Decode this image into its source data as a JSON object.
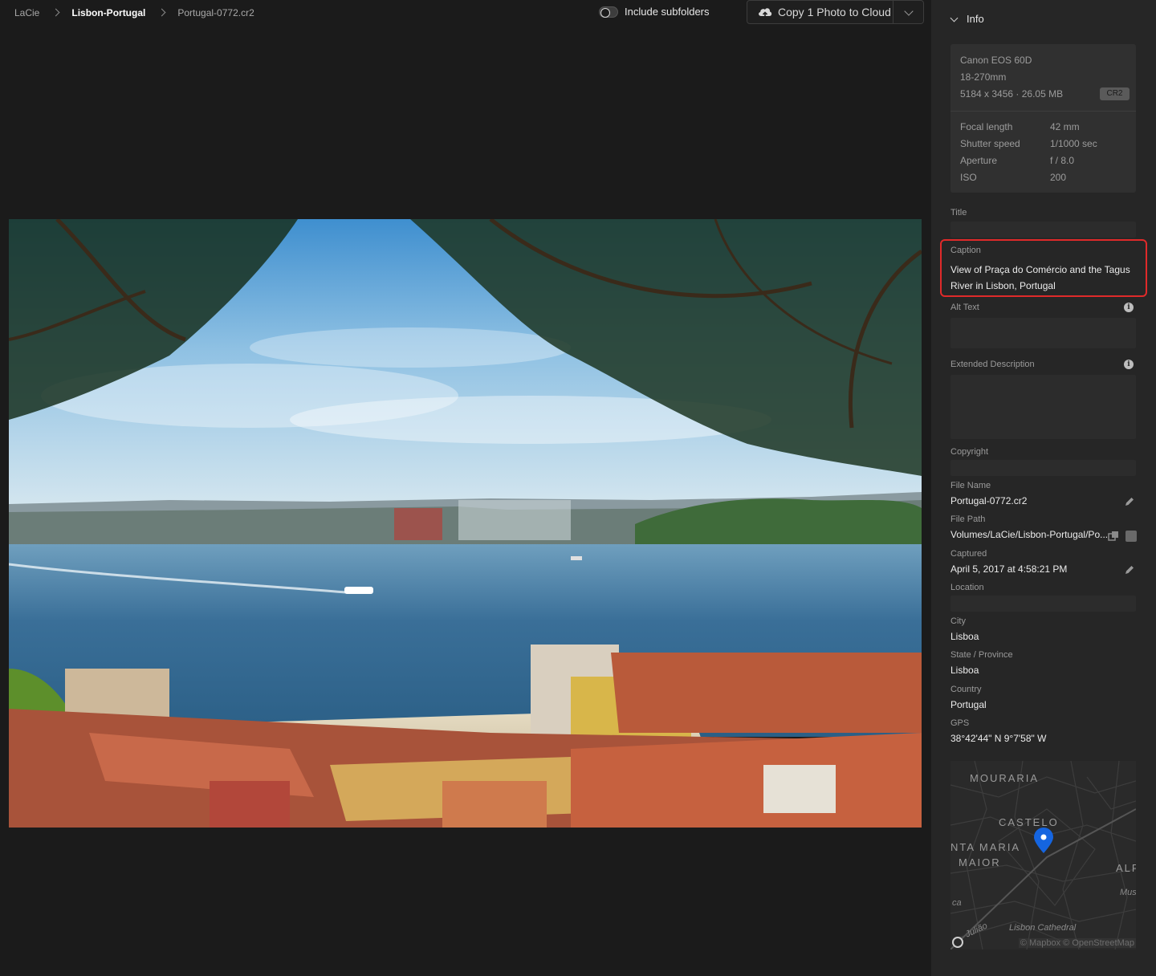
{
  "breadcrumb": {
    "root": "LaCie",
    "folder": "Lisbon-Portugal",
    "file": "Portugal-0772.cr2"
  },
  "toolbar": {
    "include_subfolders": "Include subfolders",
    "copy_button": "Copy 1 Photo to Cloud"
  },
  "panel": {
    "header": "Info",
    "camera": "Canon EOS 60D",
    "lens": "18-270mm",
    "dimensions": "5184 x 3456  ·  26.05 MB",
    "format_badge": "CR2",
    "exif": [
      {
        "label": "Focal length",
        "value": "42 mm"
      },
      {
        "label": "Shutter speed",
        "value": "1/1000 sec"
      },
      {
        "label": "Aperture",
        "value": "f / 8.0"
      },
      {
        "label": "ISO",
        "value": "200"
      }
    ],
    "title_label": "Title",
    "caption_label": "Caption",
    "caption_value": "View of Praça do Comércio and the Tagus River in Lisbon, Portugal",
    "alt_text_label": "Alt Text",
    "extended_label": "Extended Description",
    "copyright_label": "Copyright",
    "file_name_label": "File Name",
    "file_name_value": "Portugal-0772.cr2",
    "file_path_label": "File Path",
    "file_path_value": "Volumes/LaCie/Lisbon-Portugal/Po...",
    "captured_label": "Captured",
    "captured_value": "April 5, 2017 at 4:58:21 PM",
    "location_label": "Location",
    "city_label": "City",
    "city_value": "Lisboa",
    "state_label": "State / Province",
    "state_value": "Lisboa",
    "country_label": "Country",
    "country_value": "Portugal",
    "gps_label": "GPS",
    "gps_value": "38°42'44\" N 9°7'58\" W"
  },
  "map": {
    "labels": [
      "MOURARIA",
      "CASTELO",
      "NTA MARIA",
      "MAIOR",
      "ALF"
    ],
    "small_labels": [
      "Mus",
      "Lisbon Cathedral",
      "Julião",
      "ca"
    ],
    "attribution": "© Mapbox © OpenStreetMap"
  },
  "colors": {
    "background": "#1b1b1b",
    "panel": "#262626",
    "highlight": "#e02a2a",
    "pin": "#1565e0"
  }
}
